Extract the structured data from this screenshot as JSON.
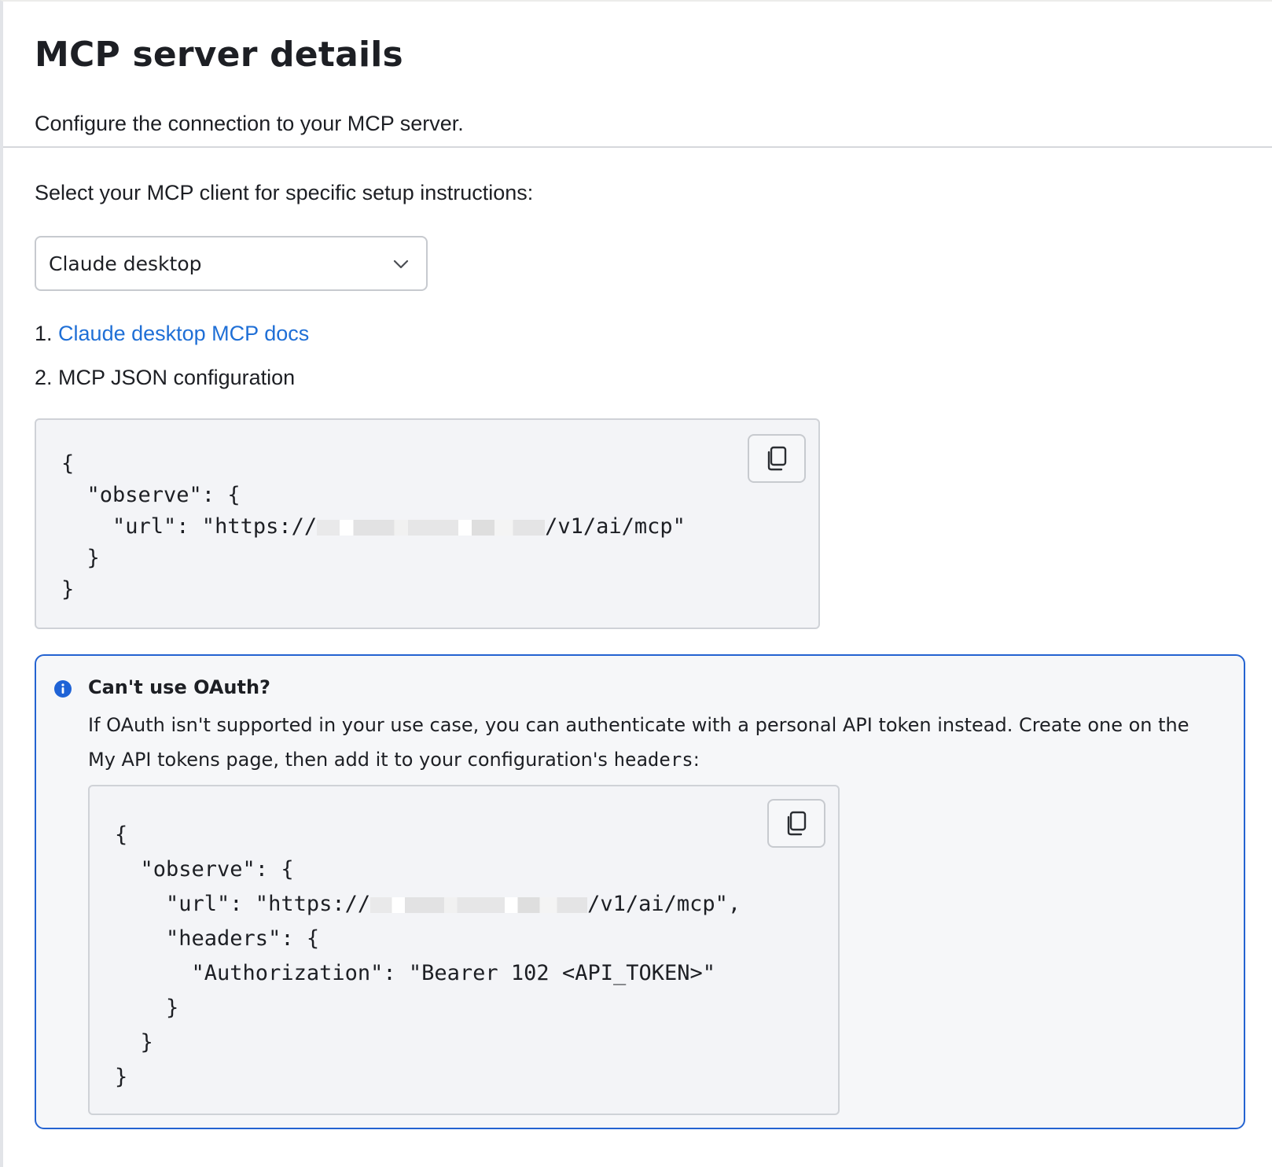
{
  "header": {
    "title": "MCP server details",
    "subtitle": "Configure the connection to your MCP server."
  },
  "client_select": {
    "prompt": "Select your MCP client for specific setup instructions:",
    "selected": "Claude desktop"
  },
  "steps": {
    "step1_number": "1.",
    "step1_link": "Claude desktop MCP docs",
    "step2": "2. MCP JSON configuration"
  },
  "config_code": {
    "line1": "{",
    "line2": "  \"observe\": {",
    "line3_prefix": "    \"url\": \"https://",
    "line3_suffix": "/v1/ai/mcp\"",
    "line4": "  }",
    "line5": "}"
  },
  "oauth_callout": {
    "title": "Can't use OAuth?",
    "body": "If OAuth isn't supported in your use case, you can authenticate with a personal API token instead. Create one on the My API tokens page, then add it to your configuration's",
    "body_code": "headers",
    "body_end": ":"
  },
  "headers_code": {
    "line1": "{",
    "line2": "  \"observe\": {",
    "line3_prefix": "    \"url\": \"https://",
    "line3_suffix": "/v1/ai/mcp\",",
    "line4": "    \"headers\": {",
    "line5": "      \"Authorization\": \"Bearer 102 <API_TOKEN>\"",
    "line6": "    }",
    "line7": "  }",
    "line8": "}"
  },
  "icons": {
    "dropdown": "chevron-down-icon",
    "copy": "copy-icon",
    "info": "info-icon"
  },
  "colors": {
    "link": "#1f6fd6",
    "callout_border": "#2463d1",
    "code_background": "#f3f4f7"
  }
}
